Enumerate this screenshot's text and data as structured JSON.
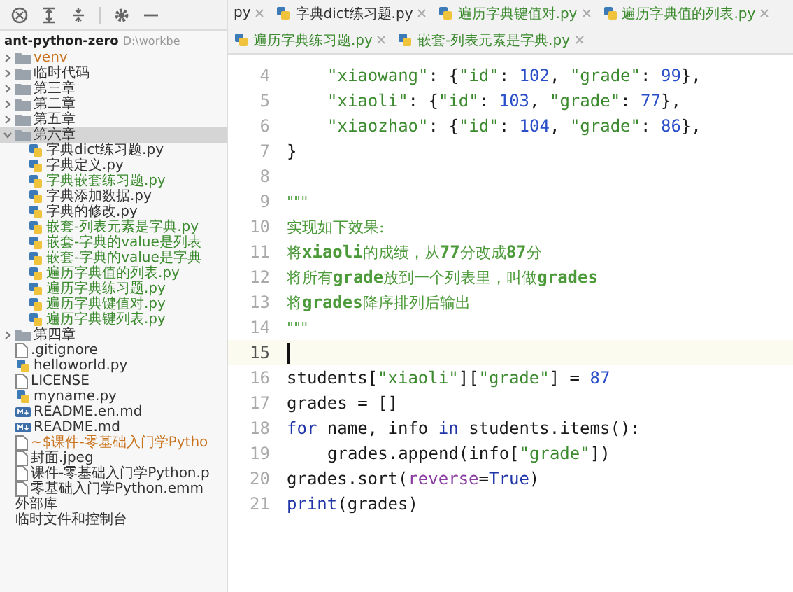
{
  "tabs": [
    {
      "label": "py",
      "color": "#333333",
      "selected": false
    },
    {
      "label": "字典dict练习题.py",
      "color": "#333333",
      "selected": false
    },
    {
      "label": "遍历字典键值对.py",
      "color": "#3b8a2e",
      "selected": false
    },
    {
      "label": "遍历字典值的列表.py",
      "color": "#3b8a2e",
      "selected": false
    },
    {
      "label": "遍历字典练习题.py",
      "color": "#3b8a2e",
      "selected": false
    },
    {
      "label": "嵌套-列表元素是字典.py",
      "color": "#3b8a2e",
      "selected": false
    }
  ],
  "project": {
    "name": "ant-python-zero",
    "path": "D:\\workbe"
  },
  "tree": [
    {
      "kind": "folder",
      "label": "venv",
      "color": "#c9731e",
      "selected": false,
      "expanded": false
    },
    {
      "kind": "folder",
      "label": "临时代码",
      "color": "#333333",
      "selected": false,
      "expanded": false
    },
    {
      "kind": "folder",
      "label": "第三章",
      "color": "#333333",
      "selected": false,
      "expanded": false
    },
    {
      "kind": "folder",
      "label": "第二章",
      "color": "#333333",
      "selected": false,
      "expanded": false
    },
    {
      "kind": "folder",
      "label": "第五章",
      "color": "#333333",
      "selected": false,
      "expanded": false
    },
    {
      "kind": "folder",
      "label": "第六章",
      "color": "#333333",
      "selected": true,
      "expanded": true,
      "children": [
        {
          "kind": "py",
          "label": "字典dict练习题.py",
          "color": "#333333",
          "selected": false
        },
        {
          "kind": "py",
          "label": "字典定义.py",
          "color": "#333333",
          "selected": false
        },
        {
          "kind": "py",
          "label": "字典嵌套练习题.py",
          "color": "#3b8a2e",
          "selected": false
        },
        {
          "kind": "py",
          "label": "字典添加数据.py",
          "color": "#333333",
          "selected": false
        },
        {
          "kind": "py",
          "label": "字典的修改.py",
          "color": "#333333",
          "selected": false
        },
        {
          "kind": "py",
          "label": "嵌套-列表元素是字典.py",
          "color": "#3b8a2e",
          "selected": false
        },
        {
          "kind": "py",
          "label": "嵌套-字典的value是列表",
          "color": "#3b8a2e",
          "selected": false
        },
        {
          "kind": "py",
          "label": "嵌套-字典的value是字典",
          "color": "#3b8a2e",
          "selected": false
        },
        {
          "kind": "py",
          "label": "遍历字典值的列表.py",
          "color": "#3b8a2e",
          "selected": false
        },
        {
          "kind": "py",
          "label": "遍历字典练习题.py",
          "color": "#3b8a2e",
          "selected": false
        },
        {
          "kind": "py",
          "label": "遍历字典键值对.py",
          "color": "#3b8a2e",
          "selected": false
        },
        {
          "kind": "py",
          "label": "遍历字典键列表.py",
          "color": "#3b8a2e",
          "selected": false
        }
      ]
    },
    {
      "kind": "folder",
      "label": "第四章",
      "color": "#333333",
      "selected": false,
      "expanded": false
    },
    {
      "kind": "file",
      "label": ".gitignore",
      "color": "#333333",
      "selected": false
    },
    {
      "kind": "py",
      "label": "helloworld.py",
      "color": "#333333",
      "selected": false
    },
    {
      "kind": "file",
      "label": "LICENSE",
      "color": "#333333",
      "selected": false
    },
    {
      "kind": "py",
      "label": "myname.py",
      "color": "#333333",
      "selected": false
    },
    {
      "kind": "md",
      "label": "README.en.md",
      "color": "#333333",
      "selected": false
    },
    {
      "kind": "md",
      "label": "README.md",
      "color": "#333333",
      "selected": false
    },
    {
      "kind": "file",
      "label": "~$课件-零基础入门学Pytho",
      "color": "#c9731e",
      "selected": false
    },
    {
      "kind": "file",
      "label": "封面.jpeg",
      "color": "#333333",
      "selected": false
    },
    {
      "kind": "file",
      "label": "课件-零基础入门学Python.p",
      "color": "#333333",
      "selected": false
    },
    {
      "kind": "file",
      "label": "零基础入门学Python.emm",
      "color": "#333333",
      "selected": false
    },
    {
      "kind": "plain",
      "label": "外部库",
      "color": "#333333",
      "selected": false
    },
    {
      "kind": "plain",
      "label": "临时文件和控制台",
      "color": "#333333",
      "selected": false
    }
  ],
  "editor": {
    "lines": [
      {
        "number": "4",
        "current": false,
        "indented": true,
        "tokens": [
          {
            "kind": "string",
            "text": "\"xiaowang\""
          },
          {
            "kind": "plain",
            "text": ": {"
          },
          {
            "kind": "string",
            "text": "\"id\""
          },
          {
            "kind": "plain",
            "text": ": "
          },
          {
            "kind": "number",
            "text": "102"
          },
          {
            "kind": "plain",
            "text": ", "
          },
          {
            "kind": "string",
            "text": "\"grade\""
          },
          {
            "kind": "plain",
            "text": ": "
          },
          {
            "kind": "number",
            "text": "99"
          },
          {
            "kind": "plain",
            "text": "},"
          }
        ]
      },
      {
        "number": "5",
        "current": false,
        "indented": true,
        "tokens": [
          {
            "kind": "string",
            "text": "\"xiaoli\""
          },
          {
            "kind": "plain",
            "text": ": {"
          },
          {
            "kind": "string",
            "text": "\"id\""
          },
          {
            "kind": "plain",
            "text": ": "
          },
          {
            "kind": "number",
            "text": "103"
          },
          {
            "kind": "plain",
            "text": ", "
          },
          {
            "kind": "string",
            "text": "\"grade\""
          },
          {
            "kind": "plain",
            "text": ": "
          },
          {
            "kind": "number",
            "text": "77"
          },
          {
            "kind": "plain",
            "text": "},"
          }
        ]
      },
      {
        "number": "6",
        "current": false,
        "indented": true,
        "tokens": [
          {
            "kind": "string",
            "text": "\"xiaozhao\""
          },
          {
            "kind": "plain",
            "text": ": {"
          },
          {
            "kind": "string",
            "text": "\"id\""
          },
          {
            "kind": "plain",
            "text": ": "
          },
          {
            "kind": "number",
            "text": "104"
          },
          {
            "kind": "plain",
            "text": ", "
          },
          {
            "kind": "string",
            "text": "\"grade\""
          },
          {
            "kind": "plain",
            "text": ": "
          },
          {
            "kind": "number",
            "text": "86"
          },
          {
            "kind": "plain",
            "text": "},"
          }
        ]
      },
      {
        "number": "7",
        "current": false,
        "indented": false,
        "tokens": [
          {
            "kind": "plain",
            "text": "}"
          }
        ]
      },
      {
        "number": "8",
        "current": false
      },
      {
        "number": "9",
        "current": false,
        "indented": false,
        "tokens": [
          {
            "kind": "doc",
            "text": "\"\"\""
          }
        ]
      },
      {
        "number": "10",
        "current": false,
        "indented": false,
        "tokens": [
          {
            "kind": "doc",
            "text": "实现如下效果:"
          }
        ]
      },
      {
        "number": "11",
        "current": false,
        "indented": false,
        "tokens": [
          {
            "kind": "doc",
            "text": "将**xiaoli**的成绩，从**77**分改成**87**分"
          }
        ]
      },
      {
        "number": "12",
        "current": false,
        "indented": false,
        "tokens": [
          {
            "kind": "doc",
            "text": "将所有**grade**放到一个列表里，叫做**grades**"
          }
        ]
      },
      {
        "number": "13",
        "current": false,
        "indented": false,
        "tokens": [
          {
            "kind": "doc",
            "text": "将**grades**降序排列后输出"
          }
        ]
      },
      {
        "number": "14",
        "current": false,
        "indented": false,
        "tokens": [
          {
            "kind": "doc",
            "text": "\"\"\""
          }
        ]
      },
      {
        "number": "15",
        "current": true
      },
      {
        "number": "16",
        "current": false,
        "indented": false,
        "tokens": [
          {
            "kind": "plain",
            "text": "students["
          },
          {
            "kind": "string",
            "text": "\"xiaoli\""
          },
          {
            "kind": "plain",
            "text": "]["
          },
          {
            "kind": "string",
            "text": "\"grade\""
          },
          {
            "kind": "plain",
            "text": "] = "
          },
          {
            "kind": "number",
            "text": "87"
          }
        ]
      },
      {
        "number": "17",
        "current": false,
        "indented": false,
        "tokens": [
          {
            "kind": "plain",
            "text": "grades = []"
          }
        ]
      },
      {
        "number": "18",
        "current": false,
        "indented": false,
        "tokens": [
          {
            "kind": "keyword",
            "text": "for"
          },
          {
            "kind": "plain",
            "text": " name, info "
          },
          {
            "kind": "keyword",
            "text": "in"
          },
          {
            "kind": "plain",
            "text": " students.items():"
          }
        ]
      },
      {
        "number": "19",
        "current": false,
        "indented": true,
        "tokens": [
          {
            "kind": "plain",
            "text": "grades.append(info["
          },
          {
            "kind": "string",
            "text": "\"grade\""
          },
          {
            "kind": "plain",
            "text": "])"
          }
        ]
      },
      {
        "number": "20",
        "current": false,
        "indented": false,
        "tokens": [
          {
            "kind": "plain",
            "text": "grades.sort("
          },
          {
            "kind": "param",
            "text": "reverse"
          },
          {
            "kind": "plain",
            "text": "="
          },
          {
            "kind": "keyword",
            "text": "True"
          },
          {
            "kind": "plain",
            "text": ")"
          }
        ]
      },
      {
        "number": "21",
        "current": false,
        "indented": false,
        "tokens": [
          {
            "kind": "builtin",
            "text": "print"
          },
          {
            "kind": "plain",
            "text": "(grades)"
          }
        ]
      }
    ]
  }
}
